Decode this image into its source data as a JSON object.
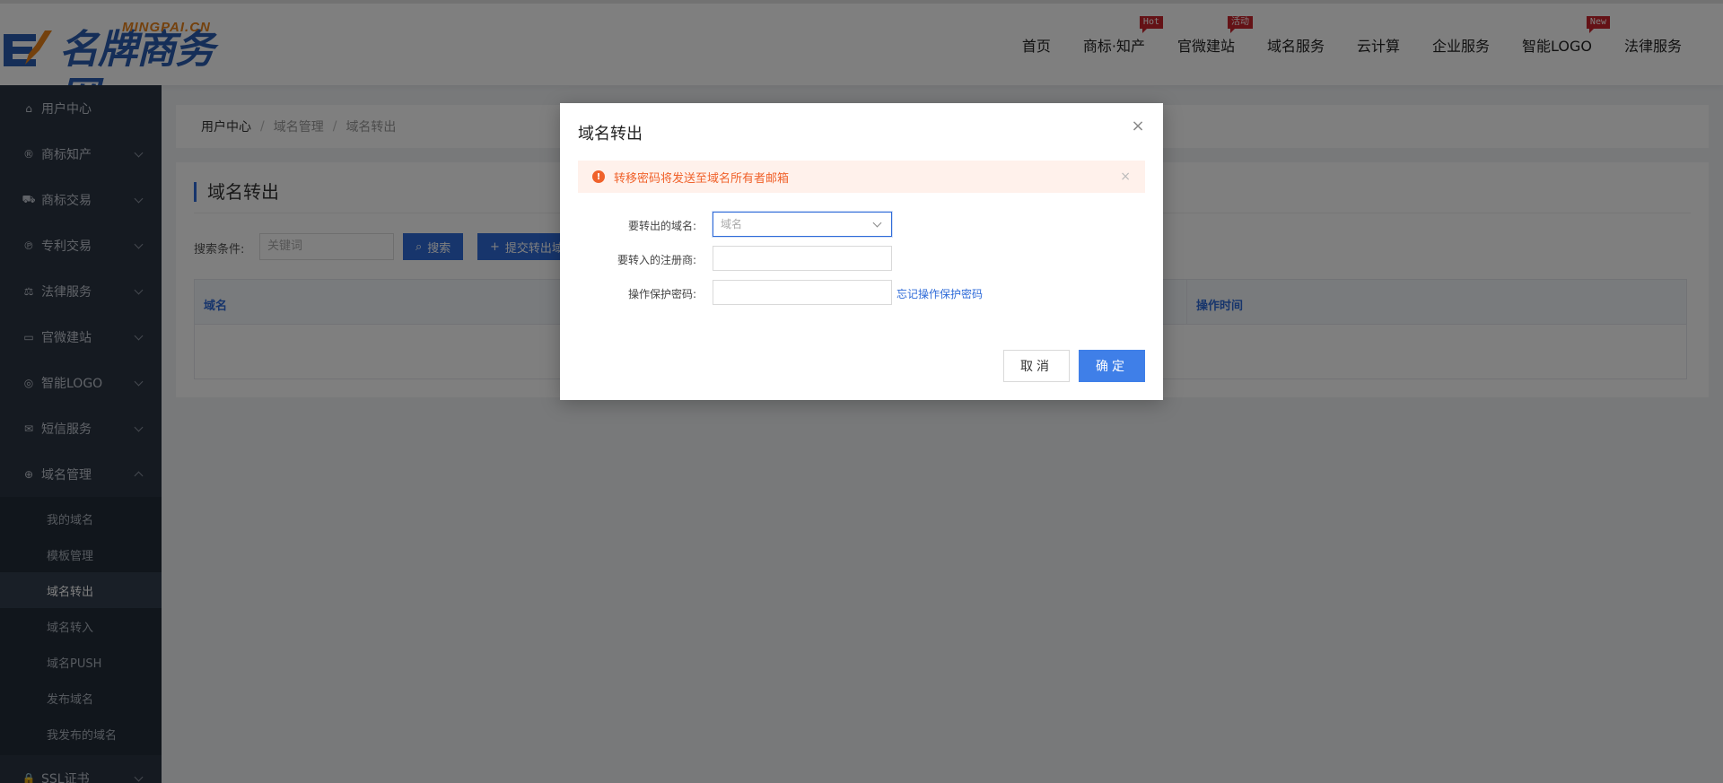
{
  "header": {
    "logo_text": "名牌商务网",
    "logo_sub": "MINGPAI.CN",
    "nav": [
      {
        "label": "首页",
        "tag": ""
      },
      {
        "label": "商标·知产",
        "tag": "Hot"
      },
      {
        "label": "官微建站",
        "tag": "活动"
      },
      {
        "label": "域名服务",
        "tag": ""
      },
      {
        "label": "云计算",
        "tag": ""
      },
      {
        "label": "企业服务",
        "tag": ""
      },
      {
        "label": "智能LOGO",
        "tag": "New"
      },
      {
        "label": "法律服务",
        "tag": ""
      }
    ]
  },
  "sidebar": {
    "items": [
      {
        "label": "用户中心",
        "icon": "home-icon"
      },
      {
        "label": "商标知产",
        "icon": "registered-icon"
      },
      {
        "label": "商标交易",
        "icon": "cart-icon"
      },
      {
        "label": "专利交易",
        "icon": "patent-icon"
      },
      {
        "label": "法律服务",
        "icon": "scale-icon"
      },
      {
        "label": "官微建站",
        "icon": "monitor-icon"
      },
      {
        "label": "智能LOGO",
        "icon": "logo-icon"
      },
      {
        "label": "短信服务",
        "icon": "mail-icon"
      },
      {
        "label": "域名管理",
        "icon": "globe-icon"
      }
    ],
    "sub_items": [
      "我的域名",
      "模板管理",
      "域名转出",
      "域名转入",
      "域名PUSH",
      "发布域名",
      "我发布的域名"
    ],
    "last_item": {
      "label": "SSL证书",
      "icon": "lock-icon"
    }
  },
  "breadcrumb": [
    "用户中心",
    "域名管理",
    "域名转出"
  ],
  "panel": {
    "title": "域名转出",
    "search_label": "搜索条件:",
    "search_placeholder": "关键词",
    "search_button": "搜索",
    "submit_button": "提交转出域",
    "table_headers": [
      "域名",
      "操作时间"
    ]
  },
  "modal": {
    "title": "域名转出",
    "alert_text": "转移密码将发送至域名所有者邮箱",
    "fields": [
      {
        "label": "要转出的域名:",
        "placeholder": "域名"
      },
      {
        "label": "要转入的注册商:",
        "placeholder": ""
      },
      {
        "label": "操作保护密码:",
        "placeholder": ""
      }
    ],
    "forgot_link": "忘记操作保护密码",
    "cancel": "取消",
    "confirm": "确定"
  },
  "colors": {
    "primary": "#2f6bd8",
    "sidebar_bg": "#2b3543",
    "alert_text": "#f0622b",
    "tag_red": "#c8242d"
  }
}
